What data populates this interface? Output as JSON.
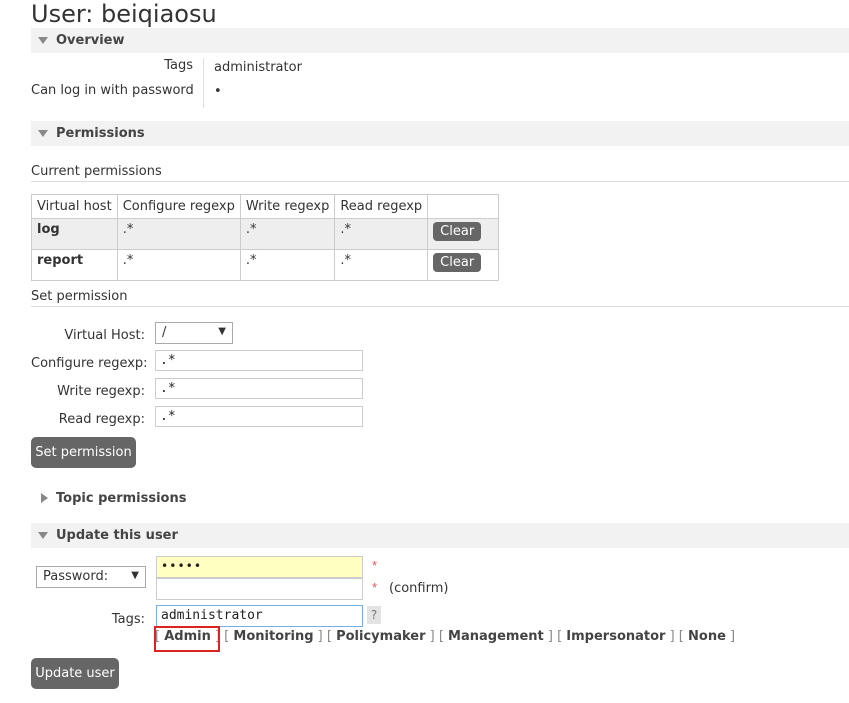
{
  "page": {
    "title": "User: beiqiaosu"
  },
  "overview": {
    "section_title": "Overview",
    "tags_label": "Tags",
    "tags_value": "administrator",
    "login_label": "Can log in with password",
    "login_value": "•"
  },
  "permissions": {
    "section_title": "Permissions",
    "current_heading": "Current permissions",
    "columns": [
      "Virtual host",
      "Configure regexp",
      "Write regexp",
      "Read regexp"
    ],
    "rows": [
      {
        "vhost": "log",
        "configure": ".*",
        "write": ".*",
        "read": ".*",
        "action": "Clear"
      },
      {
        "vhost": "report",
        "configure": ".*",
        "write": ".*",
        "read": ".*",
        "action": "Clear"
      }
    ],
    "set_heading": "Set permission",
    "form": {
      "vhost_label": "Virtual Host:",
      "vhost_value": "/",
      "configure_label": "Configure regexp:",
      "configure_value": ".*",
      "write_label": "Write regexp:",
      "write_value": ".*",
      "read_label": "Read regexp:",
      "read_value": ".*",
      "submit": "Set permission"
    }
  },
  "topic": {
    "section_title": "Topic permissions"
  },
  "update": {
    "section_title": "Update this user",
    "password_mode": "Password:",
    "password_value": "•••••",
    "confirm_label": "(confirm)",
    "required_mark": "*",
    "tags_label": "Tags:",
    "tags_value": "administrator",
    "help": "?",
    "tag_options": [
      "Admin",
      "Monitoring",
      "Policymaker",
      "Management",
      "Impersonator",
      "None"
    ],
    "submit": "Update user"
  },
  "colors": {
    "highlight_box": "#dd2222",
    "password_bg": "#ffffc0"
  }
}
